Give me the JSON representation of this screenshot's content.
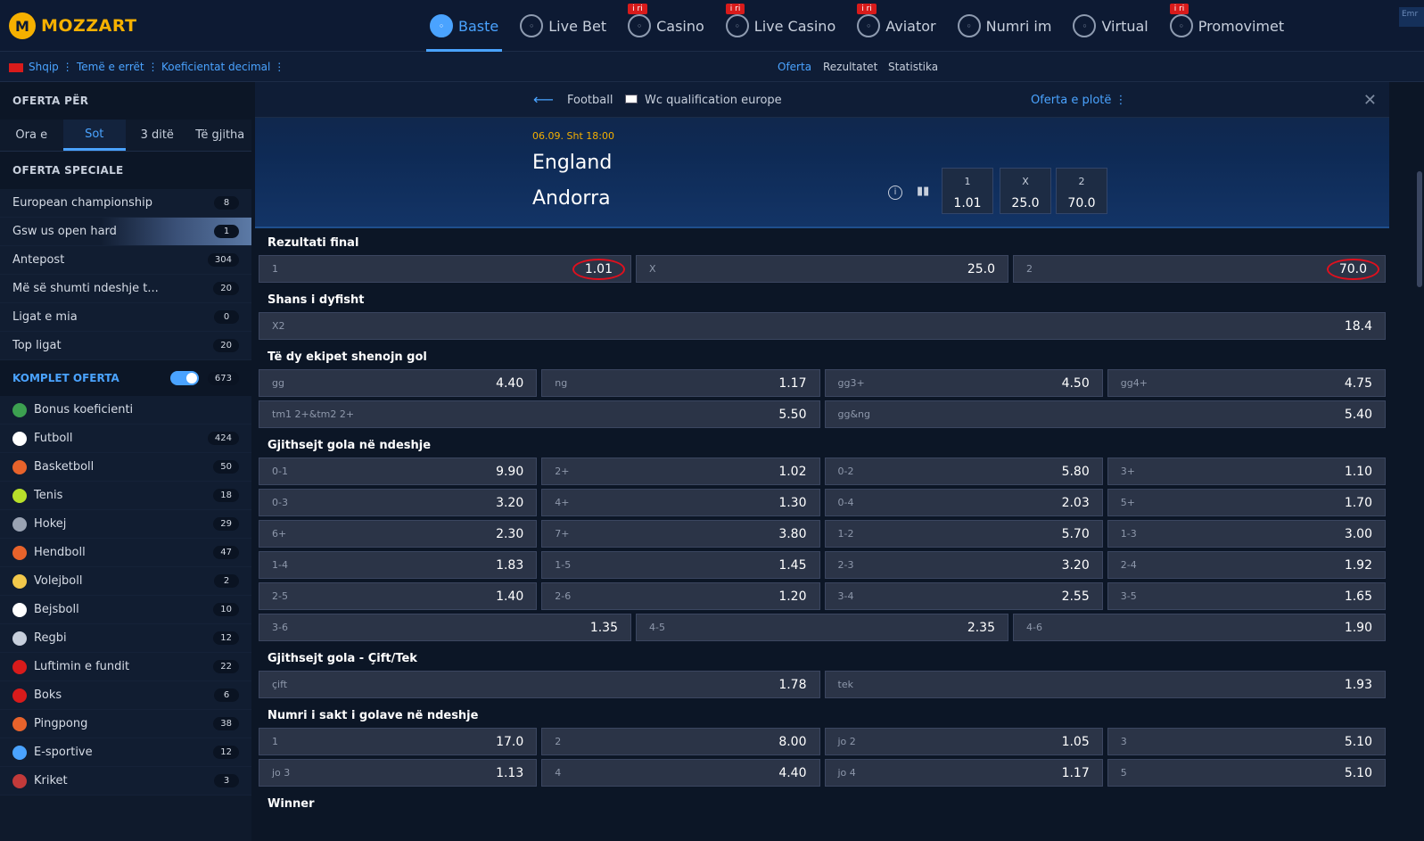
{
  "brand": {
    "logo_mark": "M",
    "logo_text": "MOZZART",
    "colors": {
      "accent": "#4aa3ff",
      "gold": "#f5b000",
      "badge": "#d81b1b"
    }
  },
  "nav": {
    "items": [
      {
        "label": "Baste",
        "icon": "soccer-ball-icon",
        "active": true,
        "badge": ""
      },
      {
        "label": "Live Bet",
        "icon": "live-bet-icon",
        "active": false,
        "badge": ""
      },
      {
        "label": "Casino",
        "icon": "cherries-icon",
        "active": false,
        "badge": "i ri"
      },
      {
        "label": "Live Casino",
        "icon": "live-casino-icon",
        "active": false,
        "badge": "i ri"
      },
      {
        "label": "Aviator",
        "icon": "plane-icon",
        "active": false,
        "badge": "i ri"
      },
      {
        "label": "Numri im",
        "icon": "number-icon",
        "active": false,
        "badge": ""
      },
      {
        "label": "Virtual",
        "icon": "virtual-icon",
        "active": false,
        "badge": ""
      },
      {
        "label": "Promovimet",
        "icon": "megaphone-icon",
        "active": false,
        "badge": "i ri"
      }
    ],
    "corner_text": "Emr"
  },
  "subbar": {
    "language": "Shqip",
    "theme": "Temë e errët",
    "odds_format": "Koeficientat decimal",
    "center": [
      "Oferta",
      "Rezultatet",
      "Statistika"
    ]
  },
  "sidebar": {
    "offer_for": "OFERTA PËR",
    "time_tabs": [
      "Ora e",
      "Sot",
      "3 ditë",
      "Të gjitha"
    ],
    "special_title": "OFERTA SPECIALE",
    "special": [
      {
        "label": "European championship",
        "count": "8"
      },
      {
        "label": "Gsw us open hard",
        "count": "1"
      },
      {
        "label": "Antepost",
        "count": "304"
      },
      {
        "label": "Më së shumti ndeshje t...",
        "count": "20"
      },
      {
        "label": "Ligat e mia",
        "count": "0"
      },
      {
        "label": "Top ligat",
        "count": "20"
      }
    ],
    "komplet": {
      "label": "KOMPLET OFERTA",
      "count": "673"
    },
    "sports": [
      {
        "label": "Bonus koeficienti",
        "count": "",
        "color": "#3ca050"
      },
      {
        "label": "Futboll",
        "count": "424",
        "color": "#ffffff"
      },
      {
        "label": "Basketboll",
        "count": "50",
        "color": "#e8632b"
      },
      {
        "label": "Tenis",
        "count": "18",
        "color": "#b8e02a"
      },
      {
        "label": "Hokej",
        "count": "29",
        "color": "#9aa3b3"
      },
      {
        "label": "Hendboll",
        "count": "47",
        "color": "#e8632b"
      },
      {
        "label": "Volejboll",
        "count": "2",
        "color": "#f2c84b"
      },
      {
        "label": "Bejsboll",
        "count": "10",
        "color": "#ffffff"
      },
      {
        "label": "Regbi",
        "count": "12",
        "color": "#c7cfdc"
      },
      {
        "label": "Luftimin e fundit",
        "count": "22",
        "color": "#d81b1b"
      },
      {
        "label": "Boks",
        "count": "6",
        "color": "#d81b1b"
      },
      {
        "label": "Pingpong",
        "count": "38",
        "color": "#e8632b"
      },
      {
        "label": "E-sportive",
        "count": "12",
        "color": "#4aa3ff"
      },
      {
        "label": "Kriket",
        "count": "3",
        "color": "#c23a3a"
      }
    ]
  },
  "match": {
    "sport": "Football",
    "league": "Wc qualification europe",
    "full_offer": "Oferta e plotë",
    "date": "06.09. Sht 18:00",
    "team1": "England",
    "team2": "Andorra",
    "main_odds": [
      {
        "k": "1",
        "v": "1.01"
      },
      {
        "k": "X",
        "v": "25.0"
      },
      {
        "k": "2",
        "v": "70.0"
      }
    ]
  },
  "markets": [
    {
      "title": "Rezultati final",
      "rows": [
        [
          {
            "k": "1",
            "v": "1.01",
            "circled": true
          },
          {
            "k": "X",
            "v": "25.0"
          },
          {
            "k": "2",
            "v": "70.0",
            "circled": true
          }
        ]
      ]
    },
    {
      "title": "Shans i dyfisht",
      "rows": [
        [
          {
            "k": "X2",
            "v": "18.4"
          }
        ]
      ]
    },
    {
      "title": "Të dy ekipet shenojn gol",
      "rows": [
        [
          {
            "k": "gg",
            "v": "4.40"
          },
          {
            "k": "ng",
            "v": "1.17"
          },
          {
            "k": "gg3+",
            "v": "4.50"
          },
          {
            "k": "gg4+",
            "v": "4.75"
          }
        ],
        [
          {
            "k": "tm1 2+&tm2 2+",
            "v": "5.50"
          },
          {
            "k": "gg&ng",
            "v": "5.40"
          }
        ]
      ]
    },
    {
      "title": "Gjithsejt gola në ndeshje",
      "rows": [
        [
          {
            "k": "0-1",
            "v": "9.90"
          },
          {
            "k": "2+",
            "v": "1.02"
          },
          {
            "k": "0-2",
            "v": "5.80"
          },
          {
            "k": "3+",
            "v": "1.10"
          }
        ],
        [
          {
            "k": "0-3",
            "v": "3.20"
          },
          {
            "k": "4+",
            "v": "1.30"
          },
          {
            "k": "0-4",
            "v": "2.03"
          },
          {
            "k": "5+",
            "v": "1.70"
          }
        ],
        [
          {
            "k": "6+",
            "v": "2.30"
          },
          {
            "k": "7+",
            "v": "3.80"
          },
          {
            "k": "1-2",
            "v": "5.70"
          },
          {
            "k": "1-3",
            "v": "3.00"
          }
        ],
        [
          {
            "k": "1-4",
            "v": "1.83"
          },
          {
            "k": "1-5",
            "v": "1.45"
          },
          {
            "k": "2-3",
            "v": "3.20"
          },
          {
            "k": "2-4",
            "v": "1.92"
          }
        ],
        [
          {
            "k": "2-5",
            "v": "1.40"
          },
          {
            "k": "2-6",
            "v": "1.20"
          },
          {
            "k": "3-4",
            "v": "2.55"
          },
          {
            "k": "3-5",
            "v": "1.65"
          }
        ],
        [
          {
            "k": "3-6",
            "v": "1.35"
          },
          {
            "k": "4-5",
            "v": "2.35"
          },
          {
            "k": "4-6",
            "v": "1.90"
          }
        ]
      ]
    },
    {
      "title": "Gjithsejt gola - Çift/Tek",
      "rows": [
        [
          {
            "k": "çift",
            "v": "1.78"
          },
          {
            "k": "tek",
            "v": "1.93"
          }
        ]
      ]
    },
    {
      "title": "Numri i sakt i golave në ndeshje",
      "rows": [
        [
          {
            "k": "1",
            "v": "17.0"
          },
          {
            "k": "2",
            "v": "8.00"
          },
          {
            "k": "jo 2",
            "v": "1.05"
          },
          {
            "k": "3",
            "v": "5.10"
          }
        ],
        [
          {
            "k": "jo 3",
            "v": "1.13"
          },
          {
            "k": "4",
            "v": "4.40"
          },
          {
            "k": "jo 4",
            "v": "1.17"
          },
          {
            "k": "5",
            "v": "5.10"
          }
        ]
      ]
    },
    {
      "title": "Winner",
      "rows": []
    }
  ]
}
